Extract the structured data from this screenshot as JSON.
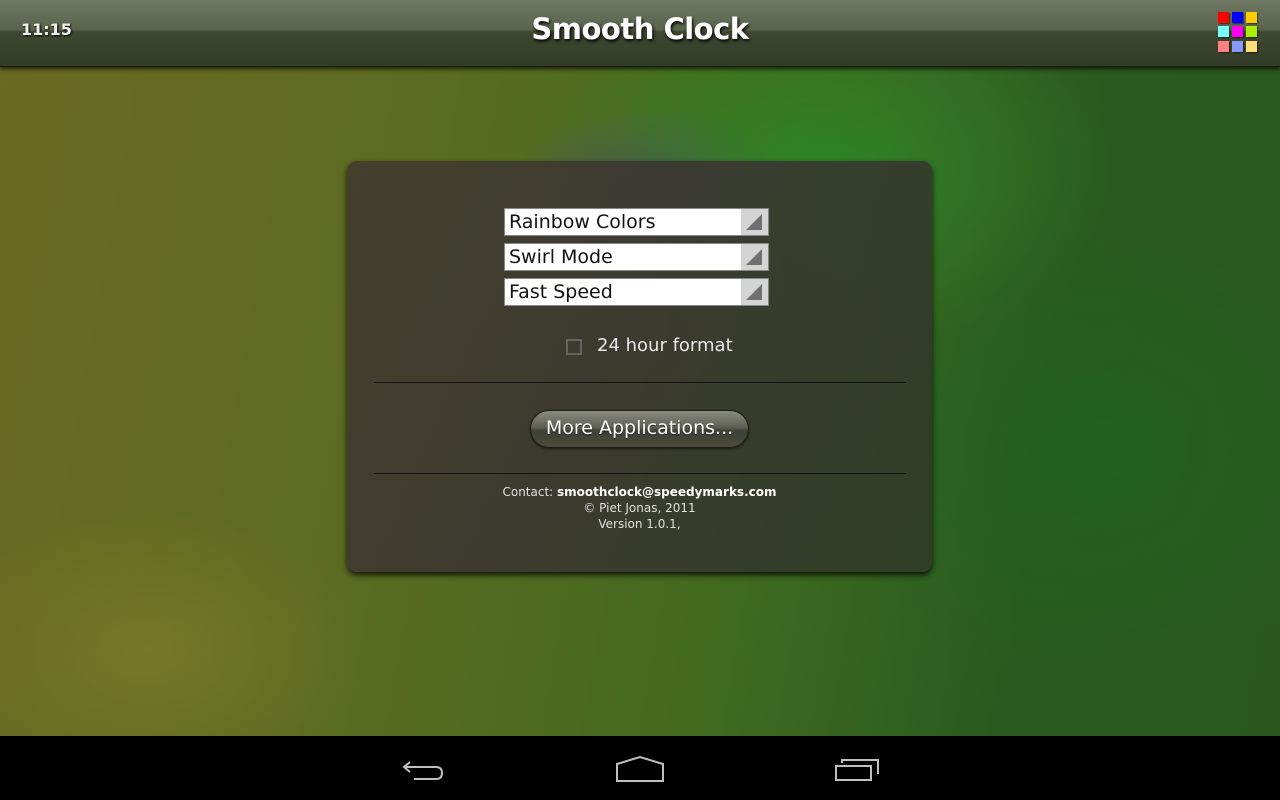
{
  "status": {
    "time": "11:15"
  },
  "header": {
    "title": "Smooth Clock",
    "menu_icon": "color-grid-icon",
    "grid_colors": [
      "#ff0000",
      "#0000ff",
      "#ffcc00",
      "#77ffff",
      "#ff00ee",
      "#aaee00",
      "#ff8080",
      "#8899ff",
      "#ffdd77"
    ]
  },
  "settings": {
    "spinners": [
      {
        "value": "Rainbow Colors"
      },
      {
        "value": "Swirl Mode"
      },
      {
        "value": "Fast Speed"
      }
    ],
    "checkbox": {
      "label": "24 hour format",
      "checked": false
    },
    "more_button": "More Applications..."
  },
  "footer": {
    "contact_label": "Contact: ",
    "contact_email": "smoothclock@speedymarks.com",
    "copyright": "© Piet Jonas, 2011",
    "version": "Version 1.0.1,"
  },
  "navbar": {
    "back": "back-icon",
    "home": "home-icon",
    "recents": "recents-icon"
  }
}
